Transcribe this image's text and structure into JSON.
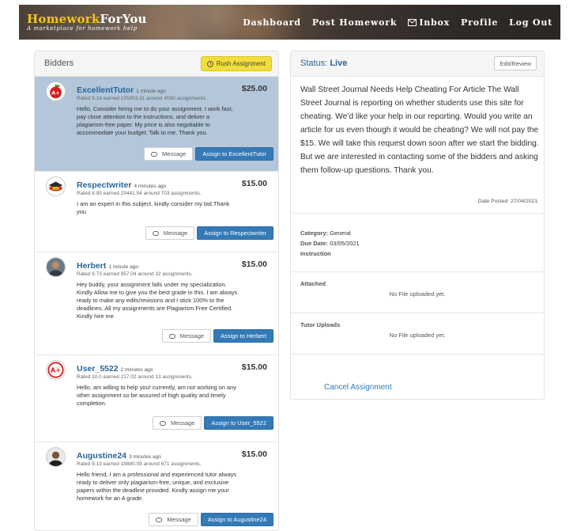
{
  "header": {
    "logo_part1": "Homework",
    "logo_part2": "ForYou",
    "tagline": "A marketplace for homework help",
    "nav": [
      "Dashboard",
      "Post Homework",
      "Inbox",
      "Profile",
      "Log Out"
    ]
  },
  "bidders_panel": {
    "title": "Bidders",
    "rush_label": "Rush Assignment",
    "message_label": "Message",
    "bids": [
      {
        "name": "ExcellentTutor",
        "ago": "1 minute ago",
        "rated": "Rated 9.14 earned 135003.21 around 4090 assignments.",
        "price": "$25.00",
        "message": "Hello, Consider hiring me to do your assignment. I work fast, pay close attention to the instructions, and deliver a plagiarism-free paper. My price is also negotiable to accommodate your budget. Talk to me. Thank you.",
        "assign": "Assign to ExcellentTutor"
      },
      {
        "name": "Respectwriter",
        "ago": "4 minutes ago",
        "rated": "Rated 8.93 earned 23441.54 around 703 assignments.",
        "price": "$15.00",
        "message": "I am an expert in this subject, kindly consider my bid.Thank you",
        "assign": "Assign to Respectwriter"
      },
      {
        "name": "Herbert",
        "ago": "1 minute ago",
        "rated": "Rated 9.73 earned 957.04 around 32 assignments.",
        "price": "$15.00",
        "message": "Hey buddy, your assignment falls under my specialization. Kindly Allow me to give you the best grade in this. I am always ready to make any edits/revisions and I stick 100% to the deadlines. All my assignments are Plagiarism Free Certified. Kindly hire me",
        "assign": "Assign to Herbert"
      },
      {
        "name": "User_5522",
        "ago": "2 minutes ago",
        "rated": "Rated 10.0 earned 217.02 around 13 assignments.",
        "price": "$15.00",
        "message": "Hello, am willing to help you! currently, am not working on any other assignment so be assured of high quality and timely completion.",
        "assign": "Assign to User_5522"
      },
      {
        "name": "Augustine24",
        "ago": "3 minutes ago",
        "rated": "Rated 9.13 earned 18880.09 around 671 assignments.",
        "price": "$15.00",
        "message": "Hello friend, I am a professional and experienced tutor always ready to deliver only plagiarism-free, unique, and exclusive papers within the deadline provided. Kindly assign me your homework for an A grade.",
        "assign": "Assign to Augustine24"
      }
    ]
  },
  "details_panel": {
    "status_prefix": "Status:",
    "status_value": "Live",
    "edit_label": "Edit/Review",
    "description": "Wall Street Journal Needs Help Cheating For Article The Wall Street Journal is reporting on whether students use this site for cheating. We’d like your help in our reporting. Would you write an article for us even though it would be cheating? We will not pay the $15. We will take this request down soon after we start the bidding. But we are interested in contacting some of the bidders and asking them follow-up questions. Thank you.",
    "date_posted": "Date Posted: 27/04/2021",
    "category_label": "Category:",
    "category_value": "General",
    "due_label": "Due Date:",
    "due_value": "03/05/2021",
    "instruction_label": "Instruction",
    "attached_label": "Attached",
    "attached_value": "No File uploaded yet.",
    "tutor_uploads_label": "Tutor Uploads",
    "tutor_uploads_value": "No File uploaded yet.",
    "cancel_label": "Cancel Assignment"
  },
  "colors": {
    "accent": "#337ab7",
    "logo_yellow": "#f5c518",
    "rush_yellow": "#f3dd3a",
    "active_bid": "#b3c6da"
  }
}
